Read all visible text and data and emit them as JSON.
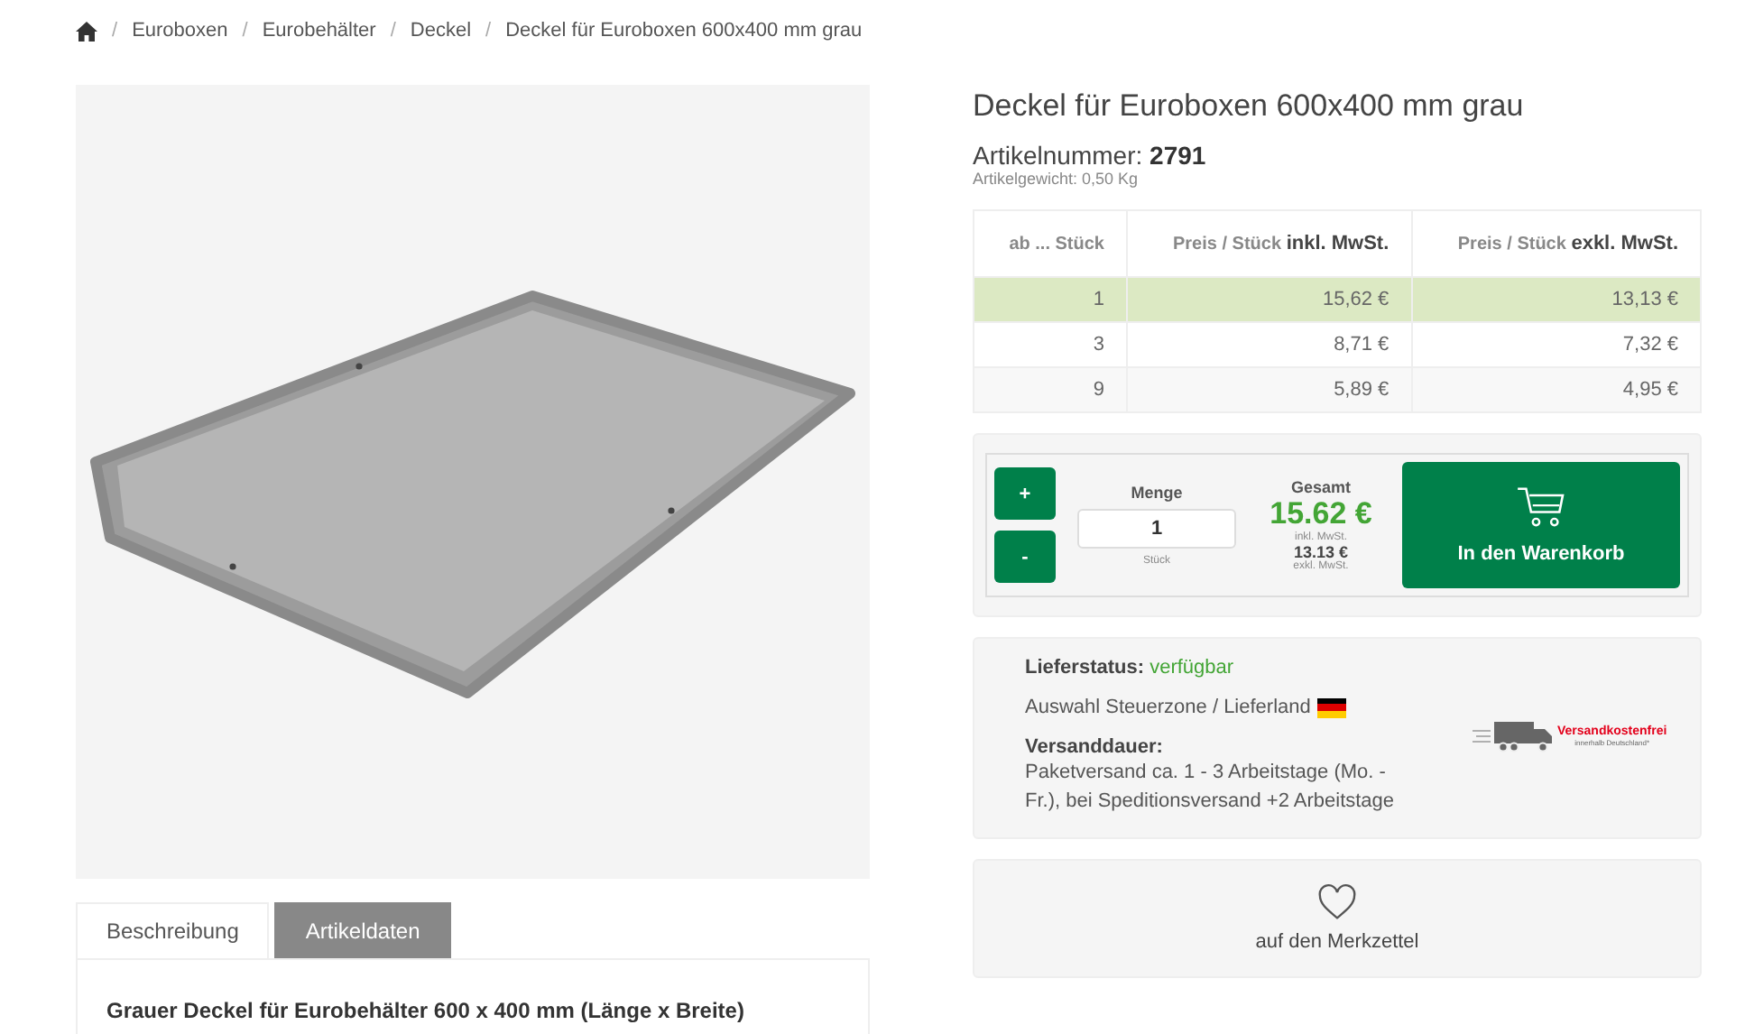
{
  "breadcrumb": [
    {
      "separator": "/",
      "label": "Euroboxen"
    },
    {
      "separator": "/",
      "label": "Eurobehälter"
    },
    {
      "separator": "/",
      "label": "Deckel"
    },
    {
      "separator": "/",
      "label": "Deckel für Euroboxen 600x400 mm grau"
    }
  ],
  "product": {
    "title": "Deckel für Euroboxen 600x400 mm grau",
    "article_label": "Artikelnummer:",
    "article_number": "2791",
    "weight": "Artikelgewicht:  0,50 Kg"
  },
  "price_table": {
    "columns": [
      {
        "small": "ab ... Stück"
      },
      {
        "small": "Preis / Stück",
        "big": "inkl. MwSt."
      },
      {
        "small": "Preis / Stück",
        "big": "exkl. MwSt."
      }
    ],
    "rows": [
      {
        "qty": "1",
        "gross": "15,62 €",
        "net": "13,13 €",
        "selected": true
      },
      {
        "qty": "3",
        "gross": "8,71 €",
        "net": "7,32 €",
        "selected": false
      },
      {
        "qty": "9",
        "gross": "5,89 €",
        "net": "4,95 €",
        "selected": false
      }
    ]
  },
  "cart": {
    "plus": "+",
    "minus": "-",
    "quantity_label": "Menge",
    "quantity": "1",
    "unit": "Stück",
    "total_label": "Gesamt",
    "total": "15.62 €",
    "total_note": "inkl. MwSt.",
    "net_total": "13.13 €",
    "net_note": "exkl. MwSt.",
    "button": "In den Warenkorb"
  },
  "delivery": {
    "status_label": "Lieferstatus:",
    "status": "verfügbar",
    "zone": "Auswahl Steuerzone / Lieferland",
    "duration_label": "Versanddauer:",
    "duration": "Paketversand ca. 1 - 3 Arbeitstage (Mo. - Fr.), bei Speditionsversand +2 Arbeitstage",
    "badge_title": "Versandkostenfrei",
    "badge_note": "innerhalb Deutschland*"
  },
  "wishlist": {
    "label": "auf den Merkzettel"
  },
  "tabs": [
    {
      "label": "Beschreibung",
      "selected": true
    },
    {
      "label": "Artikeldaten",
      "selected": false
    }
  ],
  "description": {
    "heading": "Grauer Deckel für Eurobehälter 600 x 400 mm (Länge x Breite)"
  }
}
